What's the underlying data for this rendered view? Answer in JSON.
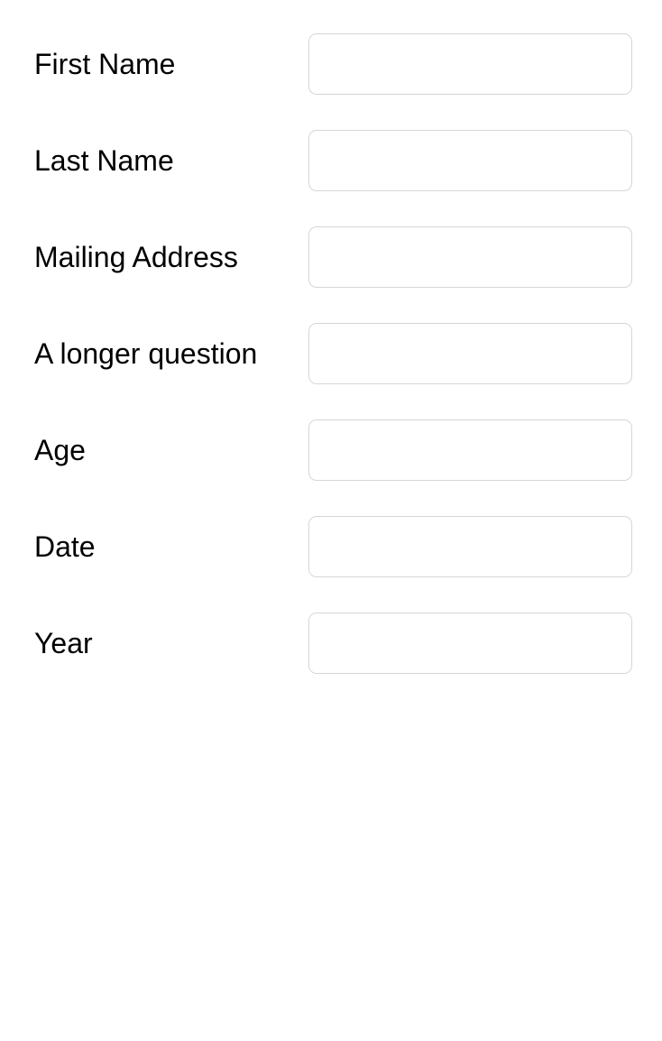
{
  "form": {
    "rows": [
      {
        "label": "First Name",
        "value": "",
        "placeholder": ""
      },
      {
        "label": "Last Name",
        "value": "",
        "placeholder": ""
      },
      {
        "label": "Mailing Address",
        "value": "",
        "placeholder": ""
      },
      {
        "label": "A longer question",
        "value": "",
        "placeholder": ""
      },
      {
        "label": "Age",
        "value": "",
        "placeholder": ""
      },
      {
        "label": "Date",
        "value": "",
        "placeholder": ""
      },
      {
        "label": "Year",
        "value": "",
        "placeholder": ""
      }
    ]
  },
  "colors": {
    "background": "#ffffff",
    "text": "#000000",
    "field_border": "#d6d6d6"
  }
}
